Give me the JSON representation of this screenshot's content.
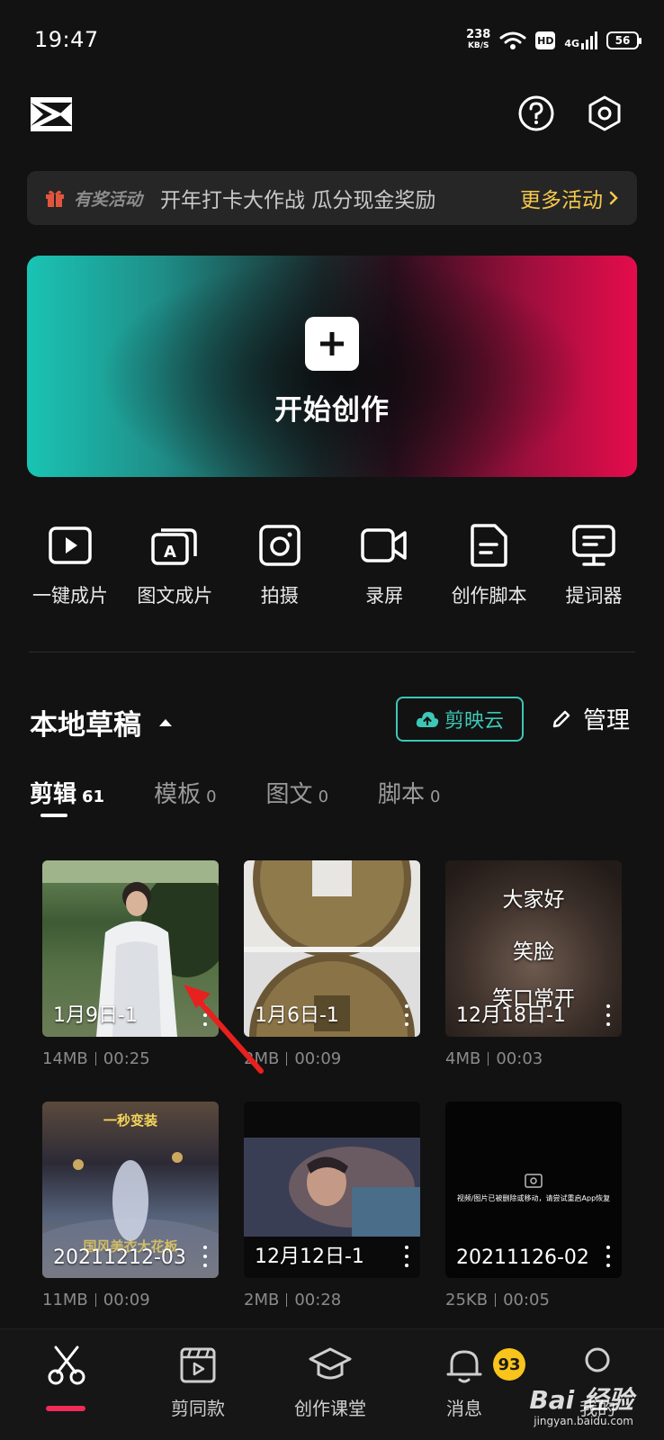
{
  "status_bar": {
    "time": "19:47",
    "net_speed": "238",
    "net_unit": "KB/S",
    "hd": "HD",
    "signal": "4G",
    "battery": "56"
  },
  "header": {
    "logo_icon": "capcut-logo",
    "help_icon": "question-circle-icon",
    "settings_icon": "hexagon-settings-icon"
  },
  "promo": {
    "tag": "有奖活动",
    "text": "开年打卡大作战 瓜分现金奖励",
    "more": "更多活动",
    "tag_color": "#e1553f",
    "more_color": "#f6c94b"
  },
  "hero": {
    "label": "开始创作"
  },
  "tools": [
    {
      "label": "一键成片",
      "icon": "play-square-icon"
    },
    {
      "label": "图文成片",
      "icon": "text-layers-icon"
    },
    {
      "label": "拍摄",
      "icon": "camera-icon"
    },
    {
      "label": "录屏",
      "icon": "video-camera-icon"
    },
    {
      "label": "创作脚本",
      "icon": "document-icon"
    },
    {
      "label": "提词器",
      "icon": "teleprompter-icon"
    }
  ],
  "drafts": {
    "title": "本地草稿",
    "cloud_button": "剪映云",
    "manage": "管理",
    "accent": "#3cc7b6",
    "tabs": [
      {
        "label": "剪辑",
        "count": "61",
        "active": true
      },
      {
        "label": "模板",
        "count": "0"
      },
      {
        "label": "图文",
        "count": "0"
      },
      {
        "label": "脚本",
        "count": "0"
      }
    ],
    "items": [
      {
        "name": "1月9日-1",
        "size": "14MB",
        "duration": "00:25"
      },
      {
        "name": "1月6日-1",
        "size": "2MB",
        "duration": "00:09"
      },
      {
        "name": "12月18日-1",
        "size": "4MB",
        "duration": "00:03",
        "overlay": [
          "大家好",
          "笑脸",
          "笑口常开"
        ]
      },
      {
        "name": "20211212-03",
        "size": "11MB",
        "duration": "00:09",
        "overlay_top": "一秒变装",
        "overlay_bottom": "国风美衣大花板"
      },
      {
        "name": "12月12日-1",
        "size": "2MB",
        "duration": "00:28"
      },
      {
        "name": "20211126-02",
        "size": "25KB",
        "duration": "00:05",
        "caption": "视频/图片已被删除或移动，请尝试重启App恢复"
      }
    ]
  },
  "bottom_nav": {
    "items": [
      {
        "label": "",
        "icon": "scissors-icon",
        "active": true
      },
      {
        "label": "剪同款",
        "icon": "clapperboard-icon"
      },
      {
        "label": "创作课堂",
        "icon": "graduation-cap-icon"
      },
      {
        "label": "消息",
        "icon": "bell-icon",
        "badge": "93"
      },
      {
        "label": "我的",
        "icon": "profile-icon"
      }
    ],
    "active_color": "#ef2b56"
  },
  "watermark": {
    "brand": "Bai 经验",
    "url": "jingyan.baidu.com"
  }
}
